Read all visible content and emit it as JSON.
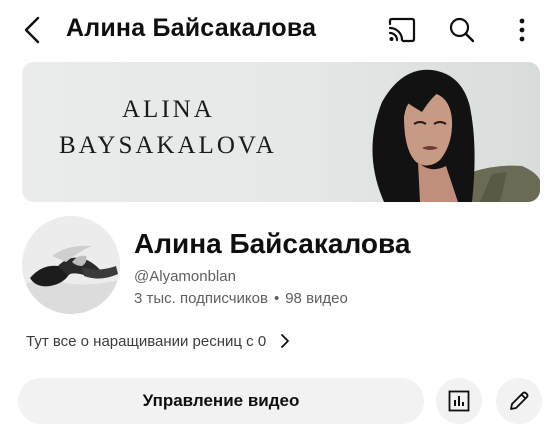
{
  "header": {
    "title": "Алина Байсакалова",
    "icons": [
      "back-arrow-icon",
      "cast-icon",
      "search-icon",
      "more-vertical-icon"
    ]
  },
  "banner": {
    "line1": "ALINA",
    "line2": "BAYSAKALOVA"
  },
  "channel": {
    "name": "Алина Байсакалова",
    "handle": "@Alyamonblan",
    "subscribers": "3 тыс. подписчиков",
    "separator": "•",
    "videos": "98 видео",
    "description": "Тут все о наращивании ресниц с 0"
  },
  "actions": {
    "manage_label": "Управление видео",
    "icons": [
      "analytics-icon",
      "pencil-icon"
    ]
  },
  "colors": {
    "background": "#ffffff",
    "text": "#0f0f0f",
    "secondary_text": "#606060",
    "button_bg": "#f2f2f2"
  }
}
